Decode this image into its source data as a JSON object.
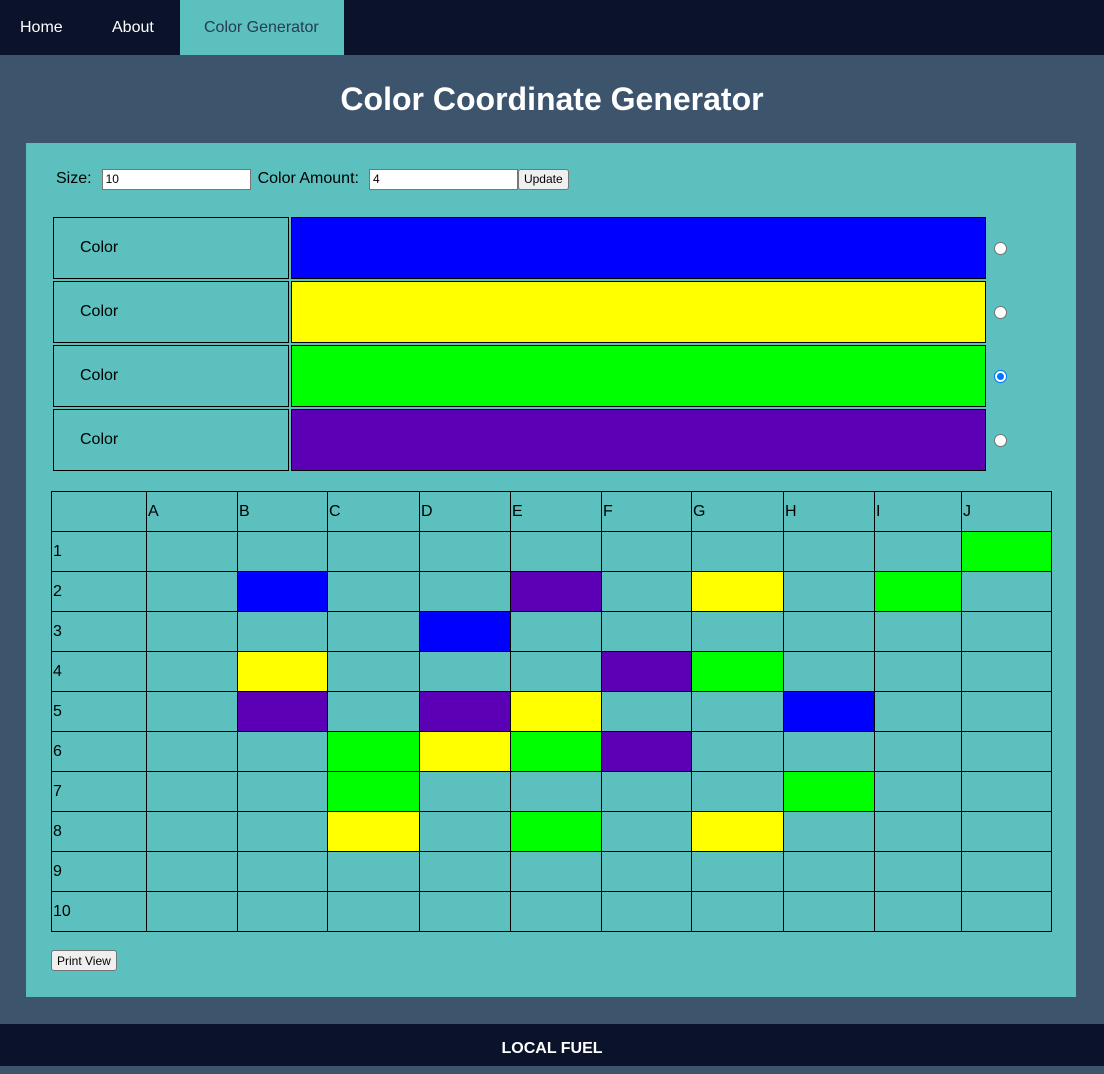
{
  "nav": {
    "items": [
      {
        "label": "Home"
      },
      {
        "label": "About"
      },
      {
        "label": "Color Generator"
      }
    ]
  },
  "page": {
    "title": "Color Coordinate Generator"
  },
  "controls": {
    "size_label": "Size:",
    "size_value": "10",
    "amount_label": "Color Amount:",
    "amount_value": "4",
    "update_label": "Update"
  },
  "colors": [
    {
      "label": "Color",
      "value": "#0000ff",
      "selected": false
    },
    {
      "label": "Color",
      "value": "#ffff00",
      "selected": false
    },
    {
      "label": "Color",
      "value": "#00ff00",
      "selected": true
    },
    {
      "label": "Color",
      "value": "#5b00b5",
      "selected": false
    }
  ],
  "grid": {
    "columns": [
      "A",
      "B",
      "C",
      "D",
      "E",
      "F",
      "G",
      "H",
      "I",
      "J"
    ],
    "rows": [
      "1",
      "2",
      "3",
      "4",
      "5",
      "6",
      "7",
      "8",
      "9",
      "10"
    ],
    "cells": [
      [
        null,
        null,
        null,
        null,
        null,
        null,
        null,
        null,
        null,
        "#00ff00"
      ],
      [
        null,
        "#0000ff",
        null,
        null,
        "#5b00b5",
        null,
        "#ffff00",
        null,
        "#00ff00",
        null
      ],
      [
        null,
        null,
        null,
        "#0000ff",
        null,
        null,
        null,
        null,
        null,
        null
      ],
      [
        null,
        "#ffff00",
        null,
        null,
        null,
        "#5b00b5",
        "#00ff00",
        null,
        null,
        null
      ],
      [
        null,
        "#5b00b5",
        null,
        "#5b00b5",
        "#ffff00",
        null,
        null,
        "#0000ff",
        null,
        null
      ],
      [
        null,
        null,
        "#00ff00",
        "#ffff00",
        "#00ff00",
        "#5b00b5",
        null,
        null,
        null,
        null
      ],
      [
        null,
        null,
        "#00ff00",
        null,
        null,
        null,
        null,
        "#00ff00",
        null,
        null
      ],
      [
        null,
        null,
        "#ffff00",
        null,
        "#00ff00",
        null,
        "#ffff00",
        null,
        null,
        null
      ],
      [
        null,
        null,
        null,
        null,
        null,
        null,
        null,
        null,
        null,
        null
      ],
      [
        null,
        null,
        null,
        null,
        null,
        null,
        null,
        null,
        null,
        null
      ]
    ]
  },
  "print_label": "Print View",
  "footer": {
    "text": "LOCAL FUEL"
  }
}
